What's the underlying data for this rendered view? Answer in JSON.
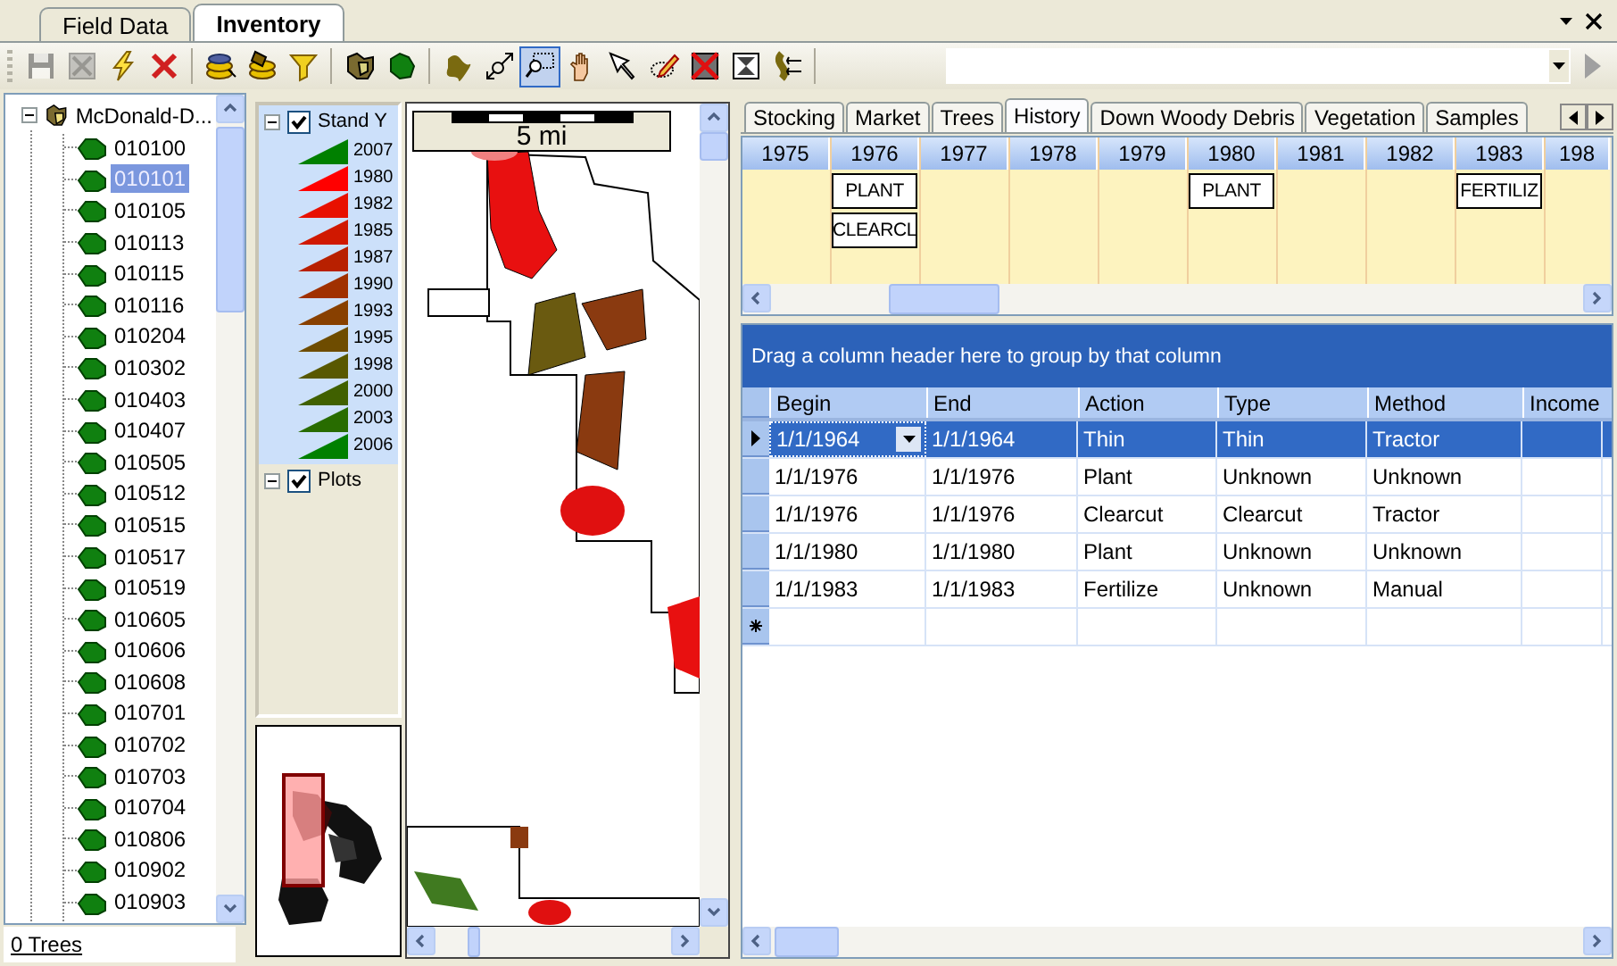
{
  "document_tabs": [
    {
      "label": "Field Data",
      "selected": false
    },
    {
      "label": "Inventory",
      "selected": true
    }
  ],
  "toolbar": {
    "groups": [
      [
        {
          "kind": "save",
          "selected": false,
          "disabled": true
        },
        {
          "kind": "crossed-square",
          "selected": false,
          "disabled": true
        },
        {
          "kind": "lightning",
          "selected": false,
          "disabled": false
        },
        {
          "kind": "x-mark",
          "selected": false,
          "disabled": false
        }
      ],
      [
        {
          "kind": "layers",
          "selected": false,
          "disabled": false
        },
        {
          "kind": "paint-bucket",
          "selected": false,
          "disabled": false
        },
        {
          "kind": "filter",
          "selected": false,
          "disabled": false
        }
      ],
      [
        {
          "kind": "map",
          "selected": false,
          "disabled": false
        },
        {
          "kind": "polygon",
          "selected": false,
          "disabled": false
        }
      ],
      [
        {
          "kind": "land-shape",
          "selected": false,
          "disabled": false
        },
        {
          "kind": "zoom-extent",
          "selected": false,
          "disabled": false
        },
        {
          "kind": "zoom-box",
          "selected": true,
          "disabled": false
        },
        {
          "kind": "hand",
          "selected": false,
          "disabled": false
        },
        {
          "kind": "pointer",
          "selected": false,
          "disabled": false
        },
        {
          "kind": "pencil",
          "selected": false,
          "disabled": false
        },
        {
          "kind": "crossed-frame",
          "selected": false,
          "disabled": false
        },
        {
          "kind": "hourglass-frame",
          "selected": false,
          "disabled": false
        },
        {
          "kind": "split-line",
          "selected": false,
          "disabled": false
        }
      ]
    ]
  },
  "tree": {
    "root": {
      "label": "McDonald-D...",
      "expanded": true,
      "children": [
        {
          "label": "010100",
          "selected": false
        },
        {
          "label": "010101",
          "selected": true
        },
        {
          "label": "010105",
          "selected": false
        },
        {
          "label": "010113",
          "selected": false
        },
        {
          "label": "010115",
          "selected": false
        },
        {
          "label": "010116",
          "selected": false
        },
        {
          "label": "010204",
          "selected": false
        },
        {
          "label": "010302",
          "selected": false
        },
        {
          "label": "010403",
          "selected": false
        },
        {
          "label": "010407",
          "selected": false
        },
        {
          "label": "010505",
          "selected": false
        },
        {
          "label": "010512",
          "selected": false
        },
        {
          "label": "010515",
          "selected": false
        },
        {
          "label": "010517",
          "selected": false
        },
        {
          "label": "010519",
          "selected": false
        },
        {
          "label": "010605",
          "selected": false
        },
        {
          "label": "010606",
          "selected": false
        },
        {
          "label": "010608",
          "selected": false
        },
        {
          "label": "010701",
          "selected": false
        },
        {
          "label": "010702",
          "selected": false
        },
        {
          "label": "010703",
          "selected": false
        },
        {
          "label": "010704",
          "selected": false
        },
        {
          "label": "010806",
          "selected": false
        },
        {
          "label": "010902",
          "selected": false
        },
        {
          "label": "010903",
          "selected": false
        }
      ]
    },
    "footer_link": "0 Trees"
  },
  "legend": {
    "layers": [
      {
        "label": "Stand Y",
        "checked": true,
        "expanded": true,
        "selected": true,
        "children": [
          {
            "label": "2007",
            "color": "#008000"
          },
          {
            "label": "1980",
            "color": "#ff0000"
          },
          {
            "label": "1982",
            "color": "#e81000"
          },
          {
            "label": "1985",
            "color": "#d01800"
          },
          {
            "label": "1987",
            "color": "#b82000"
          },
          {
            "label": "1990",
            "color": "#a03000"
          },
          {
            "label": "1993",
            "color": "#884000"
          },
          {
            "label": "1995",
            "color": "#6e4c00"
          },
          {
            "label": "1998",
            "color": "#585800"
          },
          {
            "label": "2000",
            "color": "#406000"
          },
          {
            "label": "2003",
            "color": "#286c00"
          },
          {
            "label": "2006",
            "color": "#008000"
          }
        ]
      },
      {
        "label": "Plots",
        "checked": true,
        "expanded": true,
        "selected": false
      }
    ]
  },
  "map": {
    "scale_label": "5 mi"
  },
  "detail_tabs": [
    {
      "label": "Stocking",
      "selected": false
    },
    {
      "label": "Market",
      "selected": false
    },
    {
      "label": "Trees",
      "selected": false
    },
    {
      "label": "History",
      "selected": true
    },
    {
      "label": "Down Woody Debris",
      "selected": false
    },
    {
      "label": "Vegetation",
      "selected": false
    },
    {
      "label": "Samples",
      "selected": false
    }
  ],
  "timeline": {
    "years": [
      {
        "label": "1975"
      },
      {
        "label": "1976",
        "events": [
          "PLANT",
          "CLEARCL"
        ]
      },
      {
        "label": "1977"
      },
      {
        "label": "1978"
      },
      {
        "label": "1979"
      },
      {
        "label": "1980",
        "events": [
          "PLANT"
        ]
      },
      {
        "label": "1981"
      },
      {
        "label": "1982"
      },
      {
        "label": "1983",
        "events": [
          "FERTILIZ"
        ]
      },
      {
        "label": "198"
      }
    ]
  },
  "grid": {
    "group_prompt": "Drag a column header here to group by that column",
    "columns": [
      "Begin",
      "End",
      "Action",
      "Type",
      "Method",
      "Income"
    ],
    "rows": [
      {
        "kind": "data",
        "selected": true,
        "cells": [
          "1/1/1964",
          "1/1/1964",
          "Thin",
          "Thin",
          "Tractor"
        ]
      },
      {
        "kind": "data",
        "selected": false,
        "cells": [
          "1/1/1976",
          "1/1/1976",
          "Plant",
          "Unknown",
          "Unknown"
        ]
      },
      {
        "kind": "data",
        "selected": false,
        "cells": [
          "1/1/1976",
          "1/1/1976",
          "Clearcut",
          "Clearcut",
          "Tractor"
        ]
      },
      {
        "kind": "data",
        "selected": false,
        "cells": [
          "1/1/1980",
          "1/1/1980",
          "Plant",
          "Unknown",
          "Unknown"
        ]
      },
      {
        "kind": "data",
        "selected": false,
        "cells": [
          "1/1/1983",
          "1/1/1983",
          "Fertilize",
          "Unknown",
          "Manual"
        ]
      },
      {
        "kind": "new",
        "selected": false
      }
    ]
  }
}
